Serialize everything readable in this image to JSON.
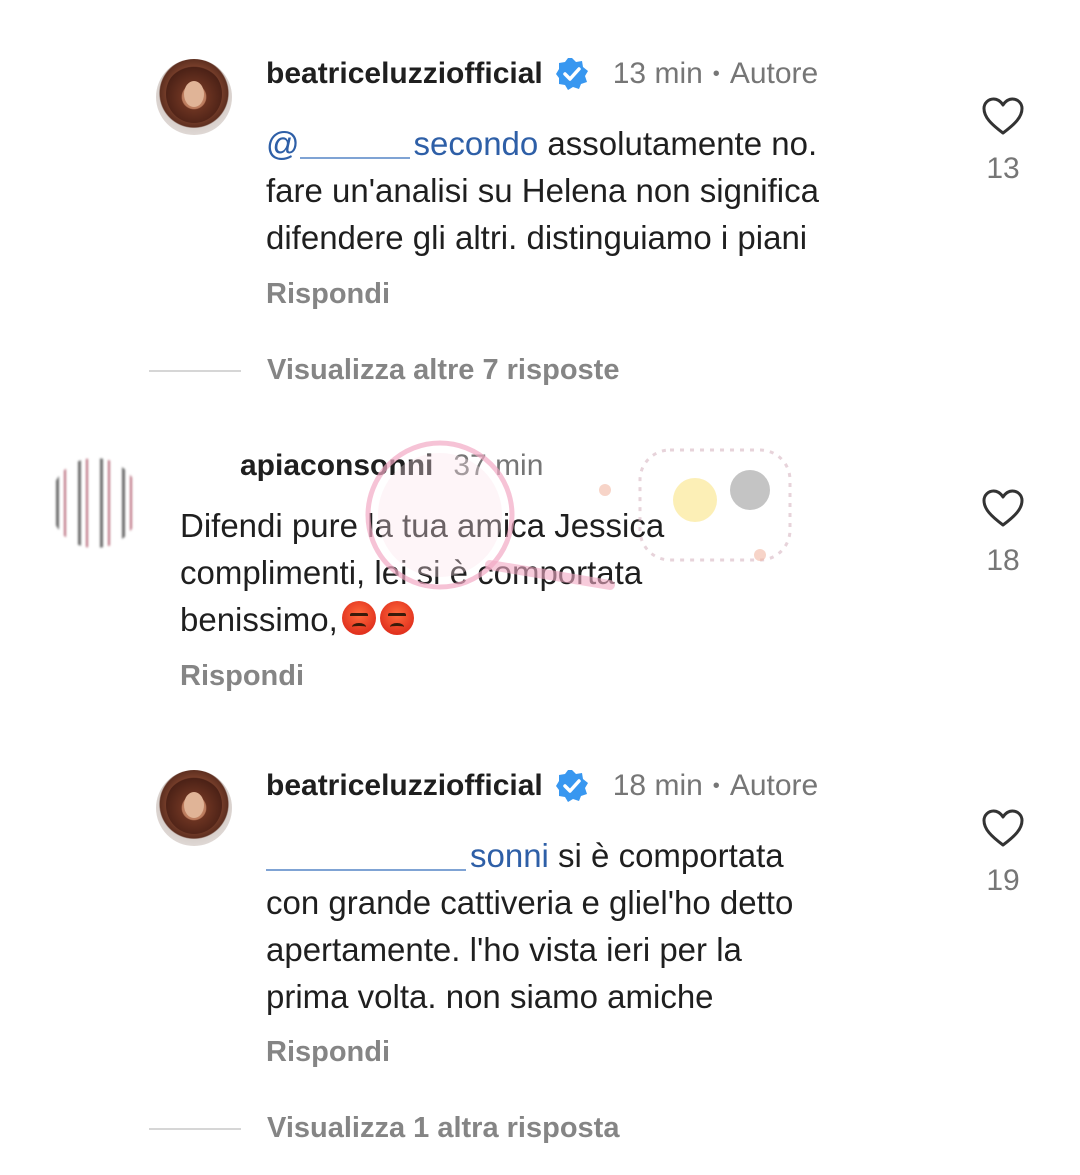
{
  "icons": {
    "like": "heart-outline-icon",
    "verified": "verified-badge-icon",
    "emoji": "angry-face-emoji"
  },
  "colors": {
    "mention": "#2e5fa7",
    "verified": "#3897f0",
    "secondary_text": "#767676"
  },
  "comments": [
    {
      "username": "beatriceluzziofficial",
      "verified": true,
      "time": "13 min",
      "separator": "•",
      "badge": "Autore",
      "mention": "@",
      "mention_tail": "secondo",
      "text_line1": " assolutamente no.",
      "text_line2": "fare un'analisi su Helena non significa",
      "text_line3": "difendere gli altri. distinguiamo i piani",
      "reply_label": "Rispondi",
      "likes": "13",
      "view_more": "Visualizza altre 7 risposte"
    },
    {
      "username": "apiaconsonni",
      "time": "37 min",
      "text_line1": "Difendi pure la tua amica Jessica",
      "text_line2": "complimenti, lei si è comportata",
      "text_line3": "benissimo,",
      "reply_label": "Rispondi",
      "likes": "18"
    },
    {
      "username": "beatriceluzziofficial",
      "verified": true,
      "time": "18 min",
      "separator": "•",
      "badge": "Autore",
      "mention_tail": "sonni",
      "text_line1": " si è comportata",
      "text_line2": "con grande cattiveria e gliel'ho detto",
      "text_line3": "apertamente. l'ho vista ieri per la",
      "text_line4": "prima volta. non siamo amiche",
      "reply_label": "Rispondi",
      "likes": "19",
      "view_more": "Visualizza 1 altra risposta"
    }
  ]
}
